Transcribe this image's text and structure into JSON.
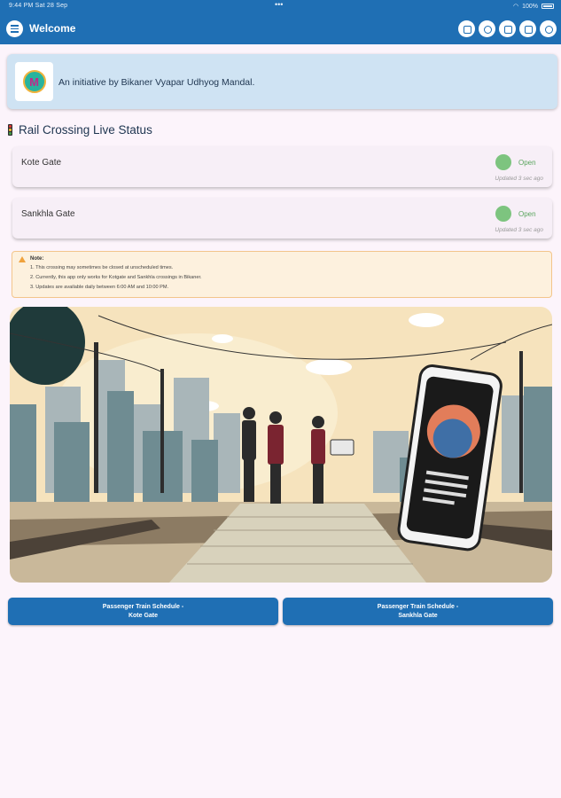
{
  "status_bar": {
    "time_date": "9:44 PM  Sat 28 Sep",
    "dots": "•••",
    "battery": "100%"
  },
  "app_bar": {
    "title": "Welcome",
    "menu_icon": "menu-icon",
    "action_icons": [
      "share-icon",
      "globe-icon",
      "instagram-icon",
      "youtube-icon",
      "camera-icon"
    ]
  },
  "banner": {
    "logo_letter": "M",
    "text": "An initiative by Bikaner Vyapar Udhyog Mandal."
  },
  "section": {
    "title": "Rail Crossing Live Status"
  },
  "gates": [
    {
      "name": "Kote Gate",
      "status": "Open",
      "updated": "Updated 3 sec ago",
      "status_color": "#7dc47f"
    },
    {
      "name": "Sankhla Gate",
      "status": "Open",
      "updated": "Updated 3 sec ago",
      "status_color": "#7dc47f"
    }
  ],
  "note": {
    "heading": "Note:",
    "lines": [
      "1. This crossing may sometimes be closed at unscheduled times.",
      "2. Currently, this app only works for Kotgate and Sankhla crossings in Bikaner.",
      "3. Updates are available daily between 6:00 AM and 10:00 PM."
    ]
  },
  "buttons": {
    "kote_line1": "Passenger Train Schedule -",
    "kote_line2": "Kote Gate",
    "sankhla_line1": "Passenger Train Schedule -",
    "sankhla_line2": "Sankhla Gate"
  },
  "colors": {
    "primary": "#1f6fb4",
    "banner_bg": "#cfe3f3",
    "open_green": "#7dc47f",
    "note_bg": "#fdf1de",
    "page_bg": "#fcf4fb"
  }
}
